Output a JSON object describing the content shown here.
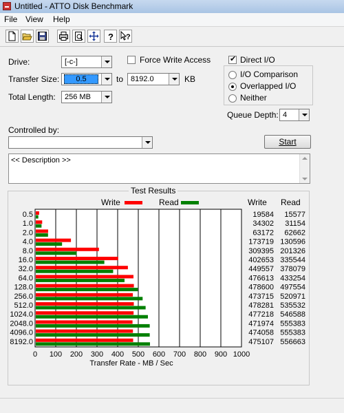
{
  "window": {
    "title": "Untitled - ATTO Disk Benchmark"
  },
  "menu": [
    "File",
    "View",
    "Help"
  ],
  "toolbar": {
    "icons": [
      "new-file-icon",
      "open-folder-icon",
      "save-icon",
      "print-icon",
      "print-preview-icon",
      "move-icon",
      "help-icon",
      "context-help-icon"
    ]
  },
  "settings": {
    "drive_label": "Drive:",
    "drive_value": "[-c-]",
    "force_write_label": "Force Write Access",
    "force_write_checked": false,
    "direct_io_label": "Direct I/O",
    "direct_io_checked": true,
    "transfer_size_label": "Transfer Size:",
    "transfer_size_from": "0.5",
    "to_label": "to",
    "transfer_size_to": "8192.0",
    "kb_label": "KB",
    "total_length_label": "Total Length:",
    "total_length_value": "256 MB",
    "io_options": [
      "I/O Comparison",
      "Overlapped I/O",
      "Neither"
    ],
    "io_selected": "Overlapped I/O",
    "queue_depth_label": "Queue Depth:",
    "queue_depth_value": "4",
    "controlled_by_label": "Controlled by:",
    "controlled_by_value": "",
    "start_label": "Start",
    "description": "<< Description >>"
  },
  "results": {
    "group_title": "Test Results",
    "write_legend": "Write",
    "read_legend": "Read",
    "write_header": "Write",
    "read_header": "Read",
    "rows": [
      {
        "size": "0.5",
        "write": "19584",
        "read": "15577"
      },
      {
        "size": "1.0",
        "write": "34302",
        "read": "31154"
      },
      {
        "size": "2.0",
        "write": "63172",
        "read": "62662"
      },
      {
        "size": "4.0",
        "write": "173719",
        "read": "130596"
      },
      {
        "size": "8.0",
        "write": "309395",
        "read": "201326"
      },
      {
        "size": "16.0",
        "write": "402653",
        "read": "335544"
      },
      {
        "size": "32.0",
        "write": "449557",
        "read": "378079"
      },
      {
        "size": "64.0",
        "write": "476613",
        "read": "433254"
      },
      {
        "size": "128.0",
        "write": "478600",
        "read": "497554"
      },
      {
        "size": "256.0",
        "write": "473715",
        "read": "520971"
      },
      {
        "size": "512.0",
        "write": "478281",
        "read": "535532"
      },
      {
        "size": "1024.0",
        "write": "477218",
        "read": "546588"
      },
      {
        "size": "2048.0",
        "write": "471974",
        "read": "555383"
      },
      {
        "size": "4096.0",
        "write": "474058",
        "read": "555383"
      },
      {
        "size": "8192.0",
        "write": "475107",
        "read": "556663"
      }
    ]
  },
  "chart_data": {
    "type": "bar",
    "orientation": "horizontal",
    "xlabel": "Transfer Rate - MB / Sec",
    "xlim": [
      0,
      1000
    ],
    "xticks": [
      0,
      100,
      200,
      300,
      400,
      500,
      600,
      700,
      800,
      900,
      1000
    ],
    "grid": true,
    "legend_position": "top",
    "categories": [
      "0.5",
      "1.0",
      "2.0",
      "4.0",
      "8.0",
      "16.0",
      "32.0",
      "64.0",
      "128.0",
      "256.0",
      "512.0",
      "1024.0",
      "2048.0",
      "4096.0",
      "8192.0"
    ],
    "series": [
      {
        "name": "Write",
        "color": "#ff0000",
        "values": [
          19.6,
          34.3,
          63.2,
          173.7,
          309.4,
          402.7,
          449.6,
          476.6,
          478.6,
          473.7,
          478.3,
          477.2,
          472.0,
          474.1,
          475.1
        ]
      },
      {
        "name": "Read",
        "color": "#008000",
        "values": [
          15.6,
          31.2,
          62.7,
          130.6,
          201.3,
          335.5,
          378.1,
          433.3,
          497.6,
          521.0,
          535.5,
          546.6,
          555.4,
          555.4,
          556.7
        ]
      }
    ]
  }
}
